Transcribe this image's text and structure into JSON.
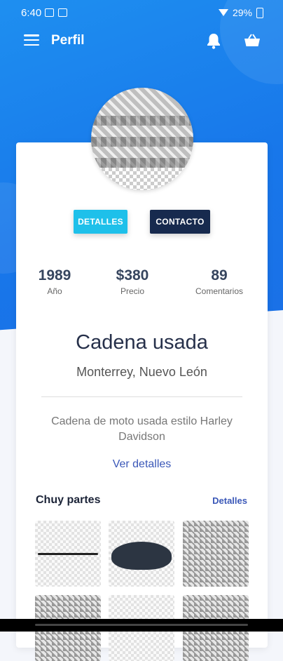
{
  "status": {
    "time": "6:40",
    "battery": "29%"
  },
  "appbar": {
    "title": "Perfil"
  },
  "buttons": {
    "details": "DETALLES",
    "contact": "CONTACTO"
  },
  "stats": [
    {
      "value": "1989",
      "label": "Año"
    },
    {
      "value": "$380",
      "label": "Precio"
    },
    {
      "value": "89",
      "label": "Comentarios"
    }
  ],
  "product": {
    "name": "Cadena usada",
    "location": "Monterrey, Nuevo León",
    "description": "Cadena de moto usada estilo Harley Davidson",
    "more_link": "Ver detalles"
  },
  "shop": {
    "name": "Chuy partes",
    "link": "Detalles"
  },
  "colors": {
    "primary": "#1a7ae9",
    "accent": "#1ec0ea",
    "dark": "#172a4e",
    "link": "#3b58b8"
  }
}
